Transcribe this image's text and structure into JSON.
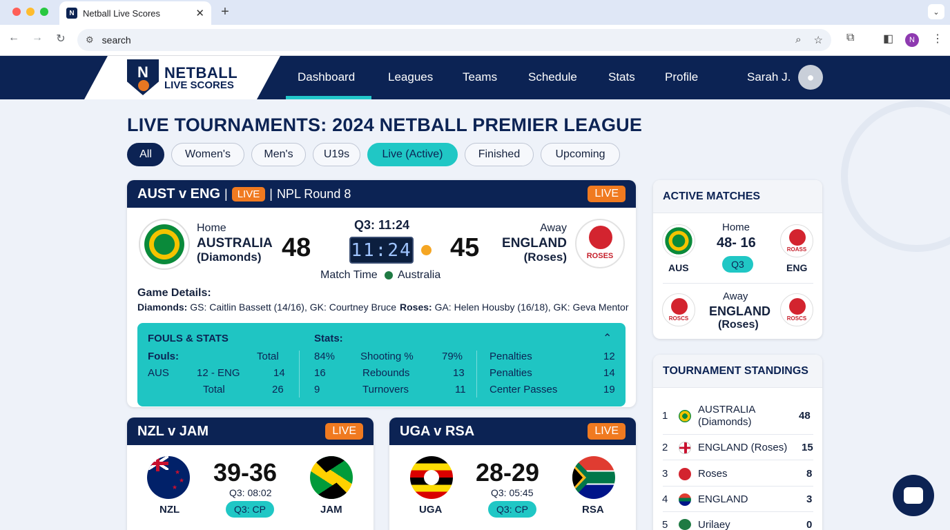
{
  "browser": {
    "tab_title": "Netball Live Scores",
    "tab_favicon": "N",
    "address": "search",
    "profile_initial": "N"
  },
  "app": {
    "logo_line1": "NETBALL",
    "logo_line2": "LIVE SCORES",
    "logo_letter": "N",
    "nav": [
      "Dashboard",
      "Leagues",
      "Teams",
      "Schedule",
      "Stats",
      "Profile"
    ],
    "active_nav": "Dashboard",
    "user": "Sarah J."
  },
  "page_title": "LIVE TOURNAMENTS: 2024 NETBALL PREMIER LEAGUE",
  "filters": [
    "All",
    "Women's",
    "Men's",
    "U19s",
    "Live (Active)",
    "Finished",
    "Upcoming"
  ],
  "featured": {
    "title": "AUST v ENG",
    "live_inline": "LIVE",
    "round": "NPL Round 8",
    "live_badge": "LIVE",
    "home_label": "Home",
    "home_team": "AUSTRALIA",
    "home_nick": "(Diamonds)",
    "home_score": "48",
    "clock_label": "Q3: 11:24",
    "clock_digits": "11:24",
    "away_score": "45",
    "away_label": "Away",
    "away_team": "ENGLAND",
    "away_nick": "(Roses)",
    "away_logo_text": "ROSES",
    "match_time_label": "Match Time",
    "match_time_team": "Australia",
    "details_heading": "Game Details:",
    "diamonds_label": "Diamonds:",
    "diamonds_text": "GS: Caitlin Bassett (14/16), GK: Courtney Bruce",
    "roses_label": "Roses:",
    "roses_text": "GA: Helen Housby (16/18), GK: Geva Mentor",
    "stats": {
      "heading": "FOULS & STATS",
      "fouls_label": "Fouls:",
      "total_label": "Total",
      "row_team": "AUS",
      "row_vs": "12 - ENG",
      "row_total": "14",
      "total_row_label": "Total",
      "total_row_value": "26",
      "stats_label": "Stats:",
      "stat_rows": [
        {
          "left": "84%",
          "name": "Shooting %",
          "right": "79%"
        },
        {
          "left": "16",
          "name": "Rebounds",
          "right": "13"
        },
        {
          "left": "9",
          "name": "Turnovers",
          "right": "11"
        }
      ],
      "extra_rows": [
        {
          "name": "Penalties",
          "value": "12"
        },
        {
          "name": "Penalties",
          "value": "14"
        },
        {
          "name": "Center Passes",
          "value": "19"
        }
      ]
    }
  },
  "small_matches": [
    {
      "title": "NZL v JAM",
      "live": "LIVE",
      "score": "39-36",
      "time": "Q3: 08:02",
      "quarter": "Q3: CP",
      "home": "NZL",
      "away": "JAM"
    },
    {
      "title": "UGA v RSA",
      "live": "LIVE",
      "score": "28-29",
      "time": "Q3: 05:45",
      "quarter": "Q3: CP",
      "home": "UGA",
      "away": "RSA"
    }
  ],
  "active_matches": {
    "heading": "ACTIVE MATCHES",
    "m1": {
      "label": "Home",
      "score": "48- 16",
      "quarter": "Q3",
      "home": "AUS",
      "away": "ENG",
      "logo_text": "ROASS"
    },
    "m2": {
      "label": "Away",
      "team": "ENGLAND",
      "nick": "(Roses)",
      "logo_text": "ROSCS"
    }
  },
  "standings": {
    "heading": "TOURNAMENT STANDINGS",
    "rows": [
      {
        "rank": "1",
        "team": "AUSTRALIA",
        "team2": "(Diamonds)",
        "points": "48"
      },
      {
        "rank": "2",
        "team": "ENGLAND (Roses)",
        "points": "15"
      },
      {
        "rank": "3",
        "team": "Roses",
        "points": "8"
      },
      {
        "rank": "4",
        "team": "ENGLAND",
        "points": "3"
      },
      {
        "rank": "5",
        "team": "Urilaey",
        "points": "0"
      }
    ]
  },
  "colors": {
    "navy": "#0c2354",
    "teal": "#20c7c5",
    "orange": "#f07a20"
  }
}
